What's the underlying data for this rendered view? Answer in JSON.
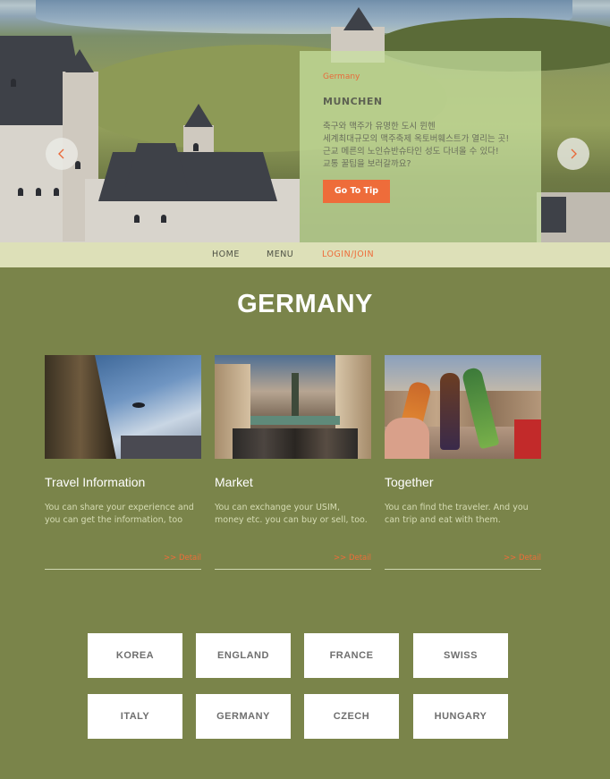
{
  "hero": {
    "country": "Germany",
    "city": "MUNCHEN",
    "description": "축구와 맥주가 유명한 도시 뮌헨\n세계최대규모의 맥주축제 옥토버훼스트가 열리는 곳!\n근교 메른의 노인슈반슈타인 성도 다녀올 수 있다!\n교통 꿀팁을 보러갈까요?",
    "button_label": "Go To Tip",
    "prev_icon": "chevron-left-icon",
    "next_icon": "chevron-right-icon"
  },
  "nav": {
    "items": [
      {
        "label": "HOME"
      },
      {
        "label": "MENU"
      },
      {
        "label": "LOGIN/JOIN"
      }
    ]
  },
  "section": {
    "title": "GERMANY"
  },
  "cards": [
    {
      "title": "Travel Information",
      "desc": "You can share your experience and you can get the information, too",
      "detail": ">> Detail"
    },
    {
      "title": "Market",
      "desc": "You can exchange your USIM, money etc. you can buy or sell, too.",
      "detail": ">> Detail"
    },
    {
      "title": "Together",
      "desc": "You can find the traveler. And you can trip and eat with them.",
      "detail": ">> Detail"
    }
  ],
  "countries": [
    {
      "label": "KOREA"
    },
    {
      "label": "ENGLAND"
    },
    {
      "label": "FRANCE"
    },
    {
      "label": "SWISS"
    },
    {
      "label": "ITALY"
    },
    {
      "label": "GERMANY"
    },
    {
      "label": "CZECH"
    },
    {
      "label": "HUNGARY"
    }
  ],
  "colors": {
    "background": "#7a844a",
    "accent": "#ee6c3a",
    "nav_bg": "#dde0b8"
  }
}
